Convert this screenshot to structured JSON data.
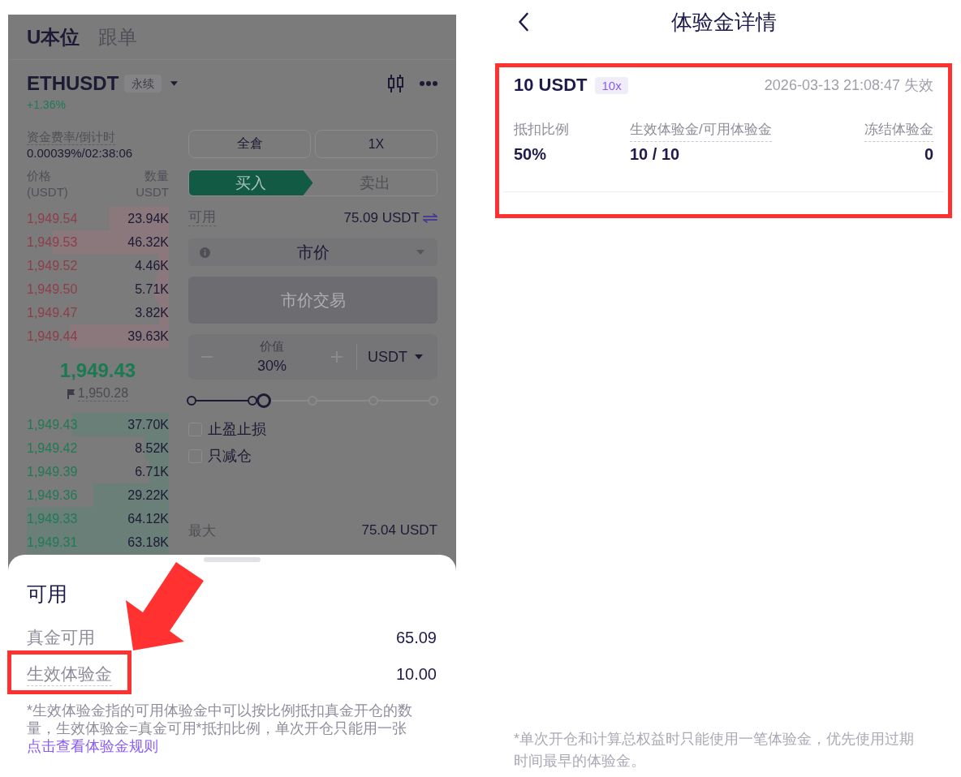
{
  "left_screen": {
    "tabs": [
      {
        "label": "U本位",
        "selected": true
      },
      {
        "label": "跟单",
        "selected": false
      }
    ],
    "symbol": {
      "name": "ETHUSDT",
      "badge": "永续",
      "change": "+1.36%"
    },
    "funding": {
      "label": "资金费率/倒计时",
      "value": "0.00039%/02:38:06"
    },
    "order_book": {
      "columns": [
        {
          "label": "价格",
          "unit": "(USDT)"
        },
        {
          "label": "数量",
          "unit": "USDT"
        }
      ],
      "asks": [
        {
          "price": "1,949.54",
          "amount": "23.94K",
          "level": 0.42
        },
        {
          "price": "1,949.53",
          "amount": "46.32K",
          "level": 0.82
        },
        {
          "price": "1,949.52",
          "amount": "4.46K",
          "level": 0.08
        },
        {
          "price": "1,949.50",
          "amount": "5.71K",
          "level": 0.1
        },
        {
          "price": "1,949.47",
          "amount": "3.82K",
          "level": 0.07
        },
        {
          "price": "1,949.44",
          "amount": "39.63K",
          "level": 0.7
        }
      ],
      "last_price": "1,949.43",
      "mark_price": "1,950.28",
      "bids": [
        {
          "price": "1,949.43",
          "amount": "37.70K",
          "level": 0.68
        },
        {
          "price": "1,949.42",
          "amount": "8.52K",
          "level": 0.17
        },
        {
          "price": "1,949.39",
          "amount": "6.71K",
          "level": 0.14
        },
        {
          "price": "1,949.36",
          "amount": "29.22K",
          "level": 0.53
        },
        {
          "price": "1,949.33",
          "amount": "64.12K",
          "level": 1
        },
        {
          "price": "1,949.31",
          "amount": "63.18K",
          "level": 1
        }
      ]
    },
    "margin_mode": "全倉",
    "leverage": "1X",
    "sides": [
      {
        "label": "买入",
        "selected": true
      },
      {
        "label": "卖出",
        "selected": false
      }
    ],
    "available": {
      "label": "可用",
      "value": "75.09 USDT"
    },
    "order_type": "市价",
    "submit": {
      "label": "市价交易",
      "disabled": true
    },
    "amount": {
      "label": "价值",
      "value": "30%",
      "unit": "USDT"
    },
    "slider": {
      "level": 0.3
    },
    "options": [
      {
        "label": "止盈止损",
        "checked": false
      },
      {
        "label": "只减仓",
        "checked": false
      }
    ],
    "max": {
      "label": "最大",
      "value": "75.04 USDT"
    }
  },
  "bottom_sheet": {
    "title": "可用",
    "rows": [
      {
        "label": "真金可用",
        "value": "65.09",
        "underlined": false,
        "highlighted": false
      },
      {
        "label": "生效体验金",
        "value": "10.00",
        "underlined": true,
        "highlighted": true
      }
    ],
    "note": "*生效体验金指的可用体验金中可以按比例抵扣真金开仓的数量，生效体验金=真金可用*抵扣比例，单次开仓只能用一张",
    "link": "点击查看体验金规则"
  },
  "detail_screen": {
    "title": "体验金详情",
    "card": {
      "highlighted": true,
      "amount": "10 USDT",
      "leverage": "10x",
      "expiry": "2026-03-13 21:08:47 失效",
      "stats": [
        {
          "label": "抵扣比例",
          "value": "50%",
          "underlined": false
        },
        {
          "label": "生效体验金/可用体验金",
          "value": "10 / 10",
          "underlined": true
        },
        {
          "label": "冻结体验金",
          "value": "0",
          "underlined": true
        }
      ]
    },
    "note": "*单次开仓和计算总权益时只能使用一笔体验金，优先使用过期时间最早的体验金。"
  }
}
